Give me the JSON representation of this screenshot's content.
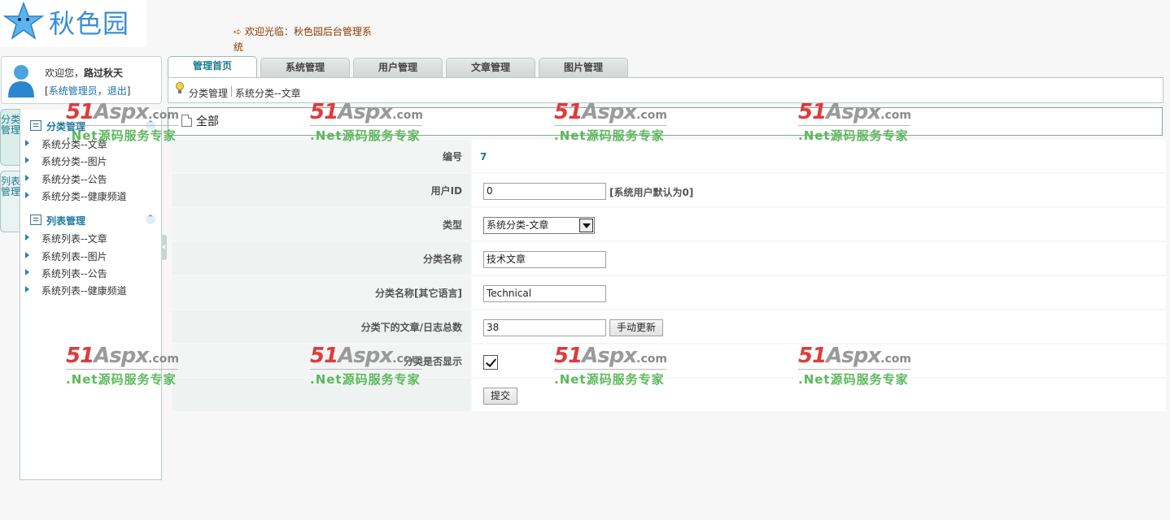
{
  "logo": {
    "text": "秋色园"
  },
  "welcome": {
    "text": "欢迎光临：秋色园后台管理系统"
  },
  "user": {
    "greeting": "欢迎您，",
    "name": "路过秋天",
    "bracket_open": "[",
    "role": "系统管理员",
    "comma": "，",
    "logout": "退出",
    "bracket_close": "]"
  },
  "vtabs": [
    "分类管理",
    "列表管理"
  ],
  "sidebar": {
    "sections": [
      {
        "title": "分类管理",
        "items": [
          "系统分类--文章",
          "系统分类--图片",
          "系统分类--公告",
          "系统分类--健康频道"
        ]
      },
      {
        "title": "列表管理",
        "items": [
          "系统列表--文章",
          "系统列表--图片",
          "系统列表--公告",
          "系统列表--健康频道"
        ]
      }
    ]
  },
  "tabs": [
    "管理首页",
    "系统管理",
    "用户管理",
    "文章管理",
    "图片管理"
  ],
  "breadcrumb": [
    "分类管理",
    "系统分类--文章"
  ],
  "allbar": {
    "label": "全部"
  },
  "form": {
    "id": {
      "label": "编号",
      "value": "7"
    },
    "user_id": {
      "label": "用户ID",
      "value": "0",
      "hint": "[系统用户默认为0]"
    },
    "type": {
      "label": "类型",
      "value": "系统分类-文章"
    },
    "name": {
      "label": "分类名称",
      "value": "技术文章"
    },
    "name_other": {
      "label": "分类名称[其它语言]",
      "value": "Technical"
    },
    "count": {
      "label": "分类下的文章/日志总数",
      "value": "38",
      "button": "手动更新"
    },
    "visible": {
      "label": "分类是否显示",
      "checked": true
    },
    "submit": "提交"
  },
  "watermark": {
    "brand": "51",
    "brand2": "Aspx",
    "tld": ".com",
    "slogan": ".Net源码服务专家"
  },
  "colors": {
    "accent": "#1c7a90",
    "link": "#1a6fa8",
    "watermark_red": "#e03a3a",
    "watermark_green": "#5cb85c"
  }
}
